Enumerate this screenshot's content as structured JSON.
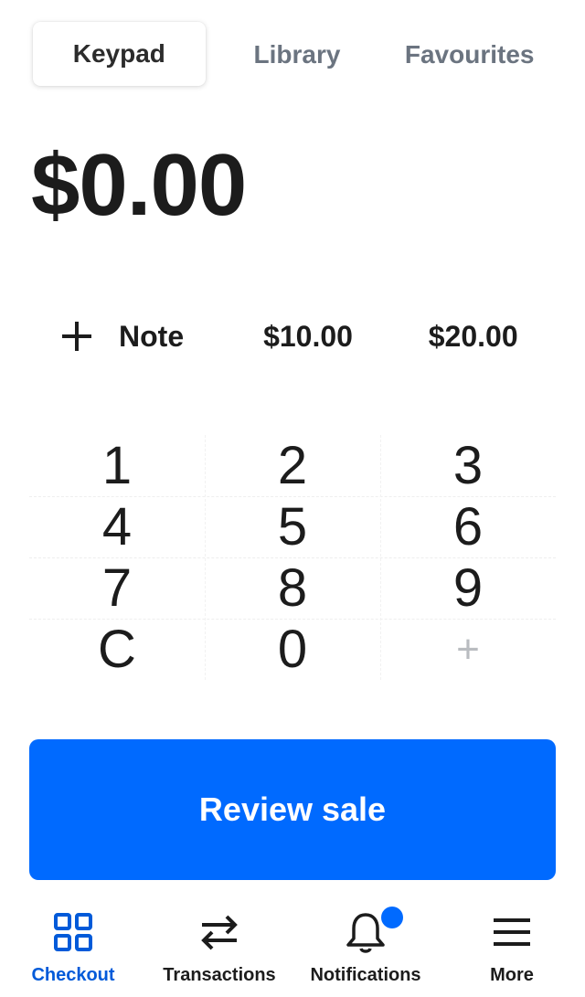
{
  "tabs": [
    {
      "label": "Keypad",
      "active": true
    },
    {
      "label": "Library",
      "active": false
    },
    {
      "label": "Favourites",
      "active": false
    }
  ],
  "amount": "$0.00",
  "quick": {
    "note_label": "Note",
    "preset_1": "$10.00",
    "preset_2": "$20.00"
  },
  "keypad": {
    "keys": [
      "1",
      "2",
      "3",
      "4",
      "5",
      "6",
      "7",
      "8",
      "9",
      "C",
      "0",
      "+"
    ]
  },
  "review_button": "Review sale",
  "nav": {
    "items": [
      {
        "label": "Checkout",
        "icon": "grid-icon",
        "active": true
      },
      {
        "label": "Transactions",
        "icon": "swap-arrows-icon",
        "active": false
      },
      {
        "label": "Notifications",
        "icon": "bell-icon",
        "active": false,
        "badge": true
      },
      {
        "label": "More",
        "icon": "menu-icon",
        "active": false
      }
    ]
  },
  "colors": {
    "accent": "#006aff",
    "active_nav": "#005ad9",
    "inactive_tab": "#6b7480",
    "text": "#1c1c1c"
  }
}
